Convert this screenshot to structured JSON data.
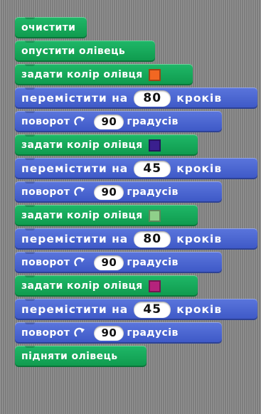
{
  "blocks": [
    {
      "type": "clear",
      "label": "очистити"
    },
    {
      "type": "pen_down",
      "label": "опустити олівець"
    },
    {
      "type": "set_pen_color",
      "label": "задати колір олівця",
      "color": "#f26722"
    },
    {
      "type": "move",
      "label": "перемістити на",
      "value": "80",
      "suffix": "кроків"
    },
    {
      "type": "turn",
      "label": "поворот",
      "value": "90",
      "suffix": "градусів"
    },
    {
      "type": "set_pen_color",
      "label": "задати колір олівця",
      "color": "#3a1f8e"
    },
    {
      "type": "move",
      "label": "перемістити на",
      "value": "45",
      "suffix": "кроків"
    },
    {
      "type": "turn",
      "label": "поворот",
      "value": "90",
      "suffix": "градусів"
    },
    {
      "type": "set_pen_color",
      "label": "задати колір олівця",
      "color": "#8fcf8a"
    },
    {
      "type": "move",
      "label": "перемістити на",
      "value": "80",
      "suffix": "кроків"
    },
    {
      "type": "turn",
      "label": "поворот",
      "value": "90",
      "suffix": "градусів"
    },
    {
      "type": "set_pen_color",
      "label": "задати колір олівця",
      "color": "#b5237c"
    },
    {
      "type": "move",
      "label": "перемістити на",
      "value": "45",
      "suffix": "кроків"
    },
    {
      "type": "turn",
      "label": "поворот",
      "value": "90",
      "suffix": "градусів"
    },
    {
      "type": "pen_up",
      "label": "підняти олівець"
    }
  ],
  "colors": {
    "pen_block": "#15a85a",
    "motion_block": "#4a66d2",
    "workspace": "#8a8a8a"
  },
  "icons": {
    "rotate": "rotate-clockwise-icon"
  }
}
